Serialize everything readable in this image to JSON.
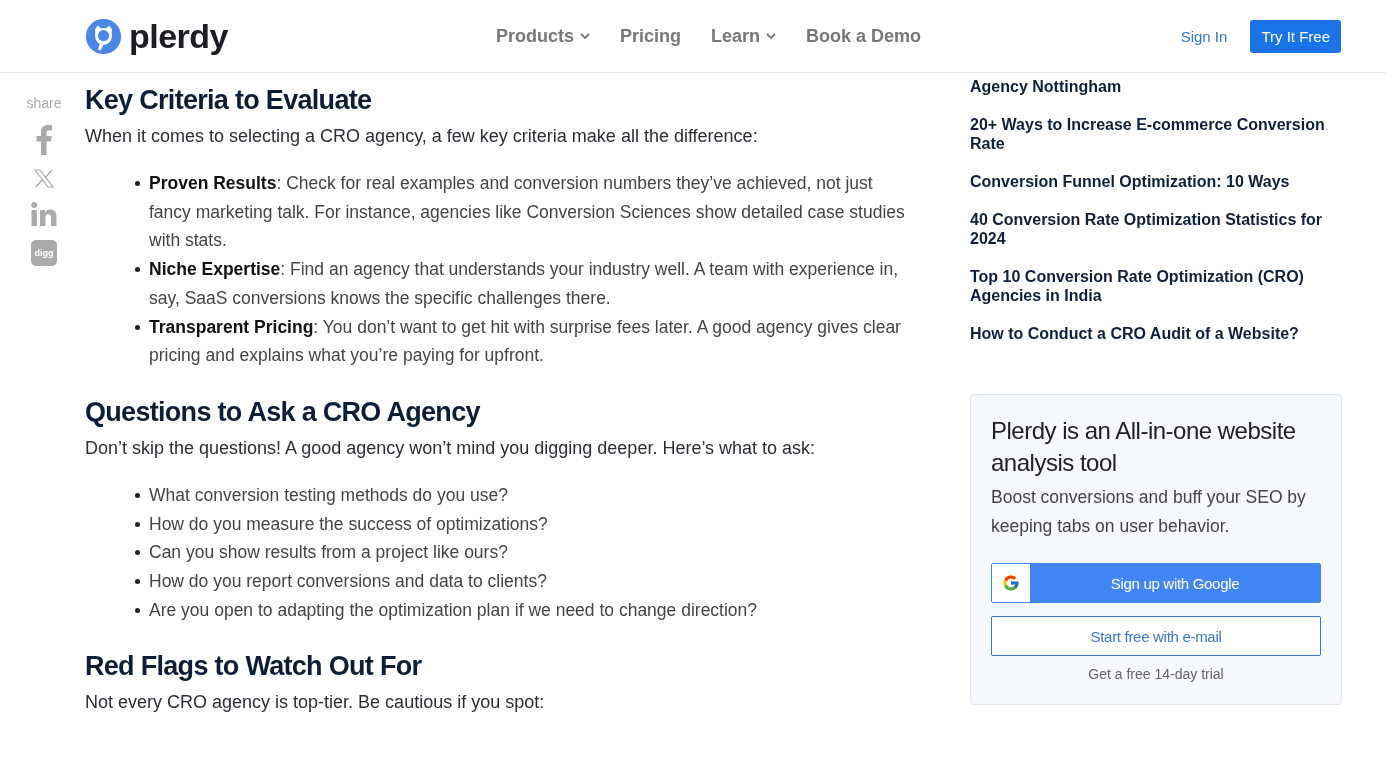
{
  "header": {
    "logo_text": "plerdy",
    "nav": [
      {
        "label": "Products",
        "dropdown": true
      },
      {
        "label": "Pricing",
        "dropdown": false
      },
      {
        "label": "Learn",
        "dropdown": true
      },
      {
        "label": "Book a Demo",
        "dropdown": false
      }
    ],
    "sign_in": "Sign In",
    "cta": "Try It Free"
  },
  "share": {
    "label": "share",
    "networks": [
      {
        "kind": "facebook"
      },
      {
        "kind": "x"
      },
      {
        "kind": "linkedin"
      },
      {
        "kind": "digg",
        "text": "digg"
      }
    ]
  },
  "article": {
    "sections": [
      {
        "heading": "Key Criteria to Evaluate",
        "intro": "When it comes to selecting a CRO agency, a few key criteria make all the difference:",
        "items": [
          "**Proven Results**: Check for real examples and conversion numbers they’ve achieved, not just fancy marketing talk. For instance, agencies like Conversion Sciences show detailed case studies with stats.",
          "**Niche Expertise**: Find an agency that understands your industry well. A team with experience in, say, SaaS conversions knows the specific challenges there.",
          "**Transparent Pricing**: You don’t want to get hit with surprise fees later. A good agency gives clear pricing and explains what you’re paying for upfront."
        ]
      },
      {
        "heading": "Questions to Ask a CRO Agency",
        "intro": "Don’t skip the questions! A good agency won’t mind you digging deeper. Here’s what to ask:",
        "items": [
          "What conversion testing methods do you use?",
          "How do you measure the success of optimizations?",
          "Can you show results from a project like ours?",
          "How do you report conversions and data to clients?",
          "Are you open to adapting the optimization plan if we need to change direction?"
        ]
      },
      {
        "heading": "Red Flags to Watch Out For",
        "intro": "Not every CRO agency is top-tier. Be cautious if you spot:"
      }
    ]
  },
  "sidebar": {
    "related": [
      "Agency Nottingham",
      "20+ Ways to Increase E-commerce Conversion Rate",
      "Conversion Funnel Optimization: 10 Ways",
      "40 Conversion Rate Optimization Statistics for 2024",
      "Top 10 Conversion Rate Optimization (CRO) Agencies in India",
      "How to Conduct a CRO Audit of a Website?"
    ],
    "promo": {
      "title": "Plerdy is an All-in-one website analysis tool",
      "text": "Boost conversions and buff your SEO by keeping tabs on user behavior.",
      "google_button": "Sign up with Google",
      "email_button": "Start free with e-mail",
      "note": "Get a free 14-day trial"
    }
  }
}
